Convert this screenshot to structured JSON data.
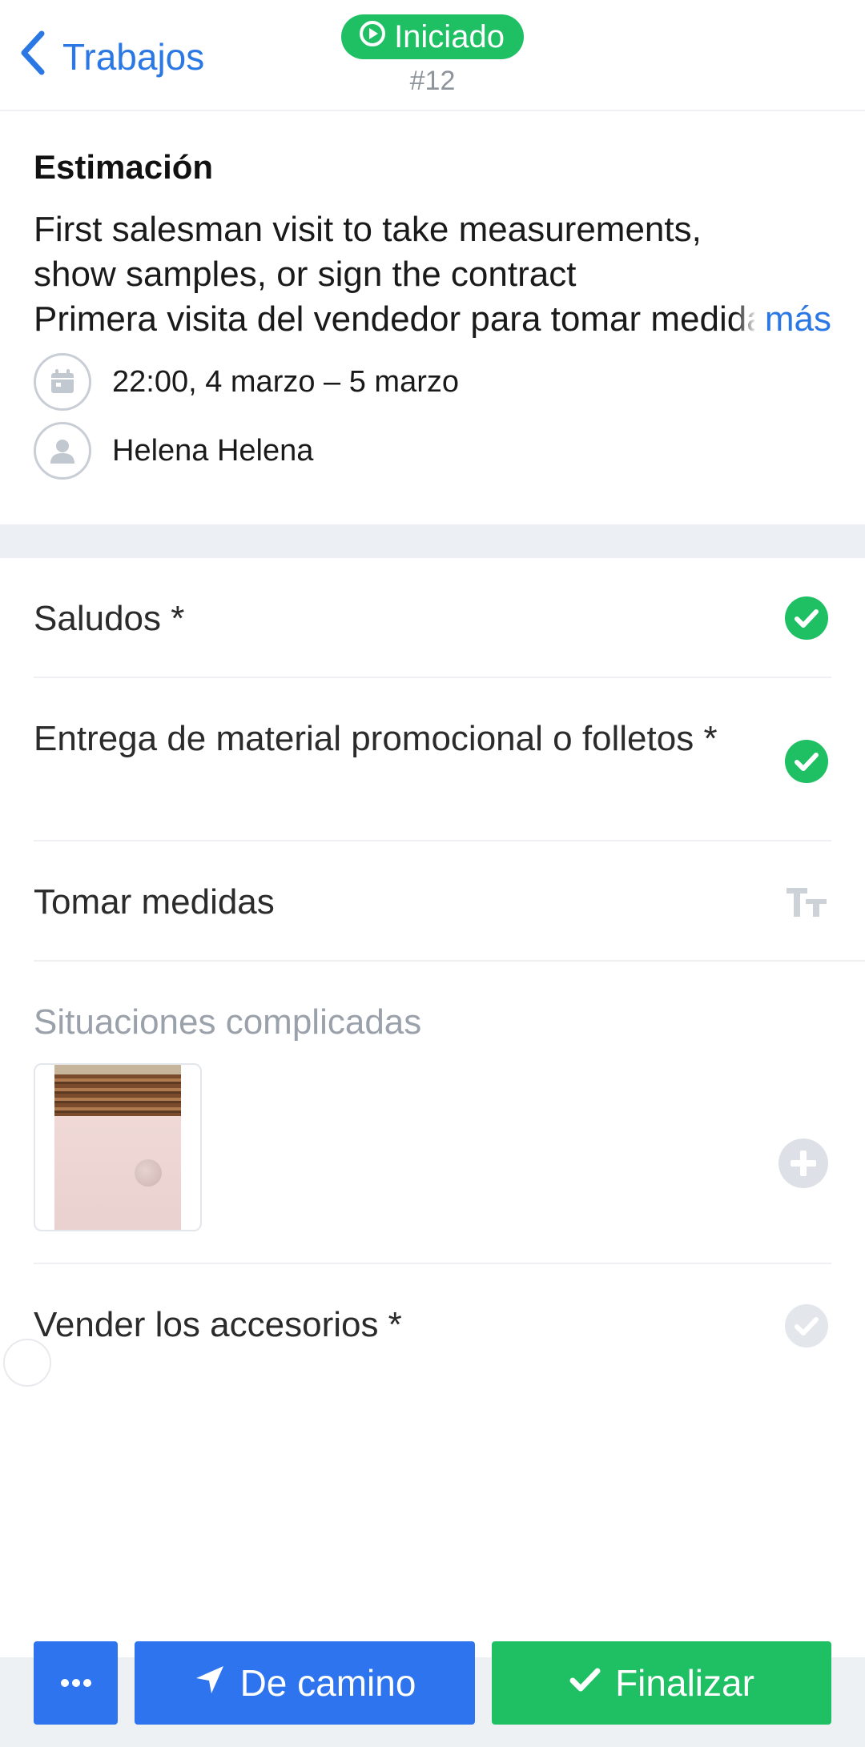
{
  "header": {
    "back_label": "Trabajos",
    "status": "Iniciado",
    "job_number": "#12"
  },
  "info": {
    "title": "Estimación",
    "description_lines": [
      "First salesman visit to take measurements,",
      "show samples, or sign the contract",
      "Primera visita del vendedor para tomar medidas"
    ],
    "more_label": "más",
    "datetime": "22:00, 4 marzo – 5 marzo",
    "assignee": "Helena Helena"
  },
  "checklist": {
    "items": [
      {
        "label": "Saludos *",
        "state": "done"
      },
      {
        "label": "Entrega de material promocional o folletos *",
        "state": "done"
      },
      {
        "label": "Tomar medidas",
        "state": "text-input"
      },
      {
        "label": "Situaciones complicadas",
        "state": "photos"
      },
      {
        "label": "Vender los accesorios *",
        "state": "pending"
      }
    ]
  },
  "actions": {
    "more_label": "···",
    "route_label": "De camino",
    "finish_label": "Finalizar"
  },
  "colors": {
    "accent_blue": "#2e74ee",
    "success_green": "#1fbf64",
    "link_blue": "#2b78e4",
    "muted_gray": "#9aa1aa"
  },
  "icons": {
    "back": "chevron-left-icon",
    "status": "play-circle-icon",
    "date": "calendar-icon",
    "assignee": "user-icon",
    "done": "check-circle-icon",
    "text_input": "text-size-icon",
    "add": "plus-circle-icon",
    "route": "navigation-arrow-icon",
    "finish": "checkmark-icon"
  }
}
